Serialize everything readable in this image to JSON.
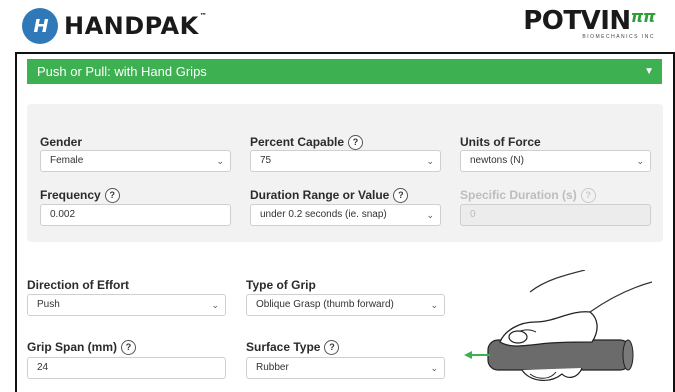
{
  "header": {
    "brand_left": "HANDPAK",
    "brand_left_mark": "H",
    "brand_right": "POTVIN",
    "brand_right_mark": "ππ",
    "brand_right_sub": "BIOMECHANICS INC"
  },
  "section": {
    "title": "Push or Pull: with Hand Grips"
  },
  "panel": {
    "gender": {
      "label": "Gender",
      "value": "Female"
    },
    "percent_capable": {
      "label": "Percent Capable",
      "value": "75"
    },
    "units": {
      "label": "Units of Force",
      "value": "newtons (N)"
    },
    "frequency": {
      "label": "Frequency",
      "value": "0.002"
    },
    "duration": {
      "label": "Duration Range or Value",
      "value": "under 0.2 seconds (ie. snap)"
    },
    "specific_duration": {
      "label": "Specific Duration (s)",
      "value": "0"
    }
  },
  "effort": {
    "direction": {
      "label": "Direction of Effort",
      "value": "Push"
    },
    "grip_type": {
      "label": "Type of Grip",
      "value": "Oblique Grasp (thumb forward)"
    },
    "grip_span": {
      "label": "Grip Span (mm)",
      "value": "24"
    },
    "surface": {
      "label": "Surface Type",
      "value": "Rubber"
    }
  },
  "help_glyph": "?",
  "dropdown_glyph": "⌄",
  "colors": {
    "accent_green": "#3db151",
    "brand_blue": "#2f79b9"
  }
}
